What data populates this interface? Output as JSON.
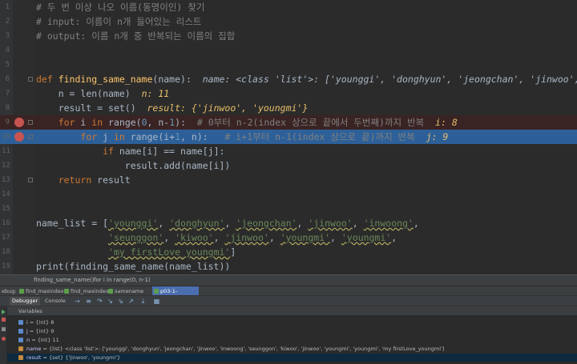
{
  "editor": {
    "lines": [
      {
        "num": "1",
        "segments": [
          {
            "c": "cm",
            "t": "# 두 번 이상 나오 이름(동명이인) 찾기"
          }
        ]
      },
      {
        "num": "2",
        "segments": [
          {
            "c": "cm",
            "t": "# input: 이름이 n개 들어있는 리스트"
          }
        ]
      },
      {
        "num": "3",
        "segments": [
          {
            "c": "cm",
            "t": "# output: 이름 n개 중 반복되는 이름의 집합"
          }
        ]
      },
      {
        "num": "4",
        "segments": []
      },
      {
        "num": "5",
        "segments": []
      },
      {
        "num": "6",
        "segments": [
          {
            "c": "kw",
            "t": "def "
          },
          {
            "c": "fn",
            "t": "finding_same_name"
          },
          {
            "c": "plain",
            "t": "(name):  "
          },
          {
            "c": "hintb",
            "t": "name: <class 'list'>: ['younggi', 'donghyun', 'jeongchan', 'jinwoo', 'inwoong', 'se"
          }
        ]
      },
      {
        "num": "7",
        "segments": [
          {
            "c": "plain",
            "t": "    n = "
          },
          {
            "c": "plain",
            "t": "len(name)  "
          },
          {
            "c": "inlinev",
            "t": "n: 11"
          }
        ]
      },
      {
        "num": "8",
        "segments": [
          {
            "c": "plain",
            "t": "    result = "
          },
          {
            "c": "plain",
            "t": "set()  "
          },
          {
            "c": "inlinev",
            "t": "result: {'jinwoo', 'youngmi'}"
          }
        ]
      },
      {
        "num": "9",
        "segments": [
          {
            "c": "plain",
            "t": "    "
          },
          {
            "c": "kw",
            "t": "for "
          },
          {
            "c": "plain",
            "t": "i "
          },
          {
            "c": "kw",
            "t": "in "
          },
          {
            "c": "plain",
            "t": "range("
          },
          {
            "c": "num",
            "t": "0"
          },
          {
            "c": "plain",
            "t": ", n-"
          },
          {
            "c": "num",
            "t": "1"
          },
          {
            "c": "plain",
            "t": "):  "
          },
          {
            "c": "cm",
            "t": "# 0부터 n-2(index 상으로 끝에서 두번째)까지 반복  "
          },
          {
            "c": "inlinev",
            "t": "i: 8"
          }
        ]
      },
      {
        "num": "10",
        "segments": [
          {
            "c": "plain",
            "t": "        "
          },
          {
            "c": "kw",
            "t": "for "
          },
          {
            "c": "plain",
            "t": "j "
          },
          {
            "c": "kw",
            "t": "in "
          },
          {
            "c": "plain",
            "t": "range(i+"
          },
          {
            "c": "num",
            "t": "1"
          },
          {
            "c": "plain",
            "t": ", n):   "
          },
          {
            "c": "cm",
            "t": "# i+1부터 n-1(index 상으로 끝)까지 반복  "
          },
          {
            "c": "inlinev",
            "t": "j: 9"
          }
        ]
      },
      {
        "num": "11",
        "segments": [
          {
            "c": "plain",
            "t": "            "
          },
          {
            "c": "kw",
            "t": "if "
          },
          {
            "c": "plain",
            "t": "name[i] == name[j]:"
          }
        ]
      },
      {
        "num": "12",
        "segments": [
          {
            "c": "plain",
            "t": "                result.add(name[i])"
          }
        ]
      },
      {
        "num": "13",
        "segments": [
          {
            "c": "plain",
            "t": "    "
          },
          {
            "c": "kw",
            "t": "return "
          },
          {
            "c": "plain",
            "t": "result"
          }
        ]
      },
      {
        "num": "14",
        "segments": []
      },
      {
        "num": "15",
        "segments": []
      },
      {
        "num": "16",
        "segments": [
          {
            "c": "plain",
            "t": "name_list = ["
          },
          {
            "c": "str wavy",
            "t": "'younggi'"
          },
          {
            "c": "plain",
            "t": ", "
          },
          {
            "c": "str wavy",
            "t": "'donghyun'"
          },
          {
            "c": "plain",
            "t": ", "
          },
          {
            "c": "str wavy",
            "t": "'jeongchan'"
          },
          {
            "c": "plain",
            "t": ", "
          },
          {
            "c": "str wavy",
            "t": "'jinwoo'"
          },
          {
            "c": "plain",
            "t": ", "
          },
          {
            "c": "str wavy",
            "t": "'inwoong'"
          },
          {
            "c": "plain",
            "t": ","
          }
        ]
      },
      {
        "num": "17",
        "segments": [
          {
            "c": "plain",
            "t": "             "
          },
          {
            "c": "str wavy",
            "t": "'seunggon'"
          },
          {
            "c": "plain",
            "t": ", "
          },
          {
            "c": "str wavy",
            "t": "'kiwoo'"
          },
          {
            "c": "plain",
            "t": ", "
          },
          {
            "c": "str wavy",
            "t": "'jinwoo'"
          },
          {
            "c": "plain",
            "t": ", "
          },
          {
            "c": "str wavy",
            "t": "'youngmi'"
          },
          {
            "c": "plain",
            "t": ", "
          },
          {
            "c": "str wavy",
            "t": "'youngmi'"
          },
          {
            "c": "plain",
            "t": ","
          }
        ]
      },
      {
        "num": "18",
        "segments": [
          {
            "c": "plain",
            "t": "             "
          },
          {
            "c": "str wavy",
            "t": "'my firstLove_youngmi'"
          },
          {
            "c": "plain",
            "t": "]"
          }
        ]
      },
      {
        "num": "19",
        "segments": [
          {
            "c": "plain",
            "t": "print(finding_same_name(name_list))"
          }
        ]
      }
    ]
  },
  "breadcrumbs": {
    "first": "finding_same_name()",
    "second": "for i in range(0, n-1)"
  },
  "tabs": [
    {
      "label": "ebug:",
      "active": false
    },
    {
      "label": "find_maxindex",
      "active": false
    },
    {
      "label": "find_maxindex",
      "active": false
    },
    {
      "label": "samename",
      "active": false
    },
    {
      "label": "p03-1-samename",
      "active": true
    }
  ],
  "debugger": {
    "debugger_tab": "Debugger",
    "console_tab": "Console",
    "variables_label": "Variables"
  },
  "variables": [
    {
      "name": "i",
      "value": "= {int} 8"
    },
    {
      "name": "j",
      "value": "= {int} 9"
    },
    {
      "name": "n",
      "value": "= {int} 11"
    },
    {
      "name": "name",
      "value": "= {list} <class 'list'>: ['younggi', 'donghyun', 'jeongchan', 'jinwoo', 'inwoong', 'seunggon', 'kiwoo', 'jinwoo', 'youngmi', 'youngmi', 'my firstLove_youngmi']"
    },
    {
      "name": "result",
      "value": "= {set} {'jinwoo', 'youngmi'}"
    }
  ]
}
